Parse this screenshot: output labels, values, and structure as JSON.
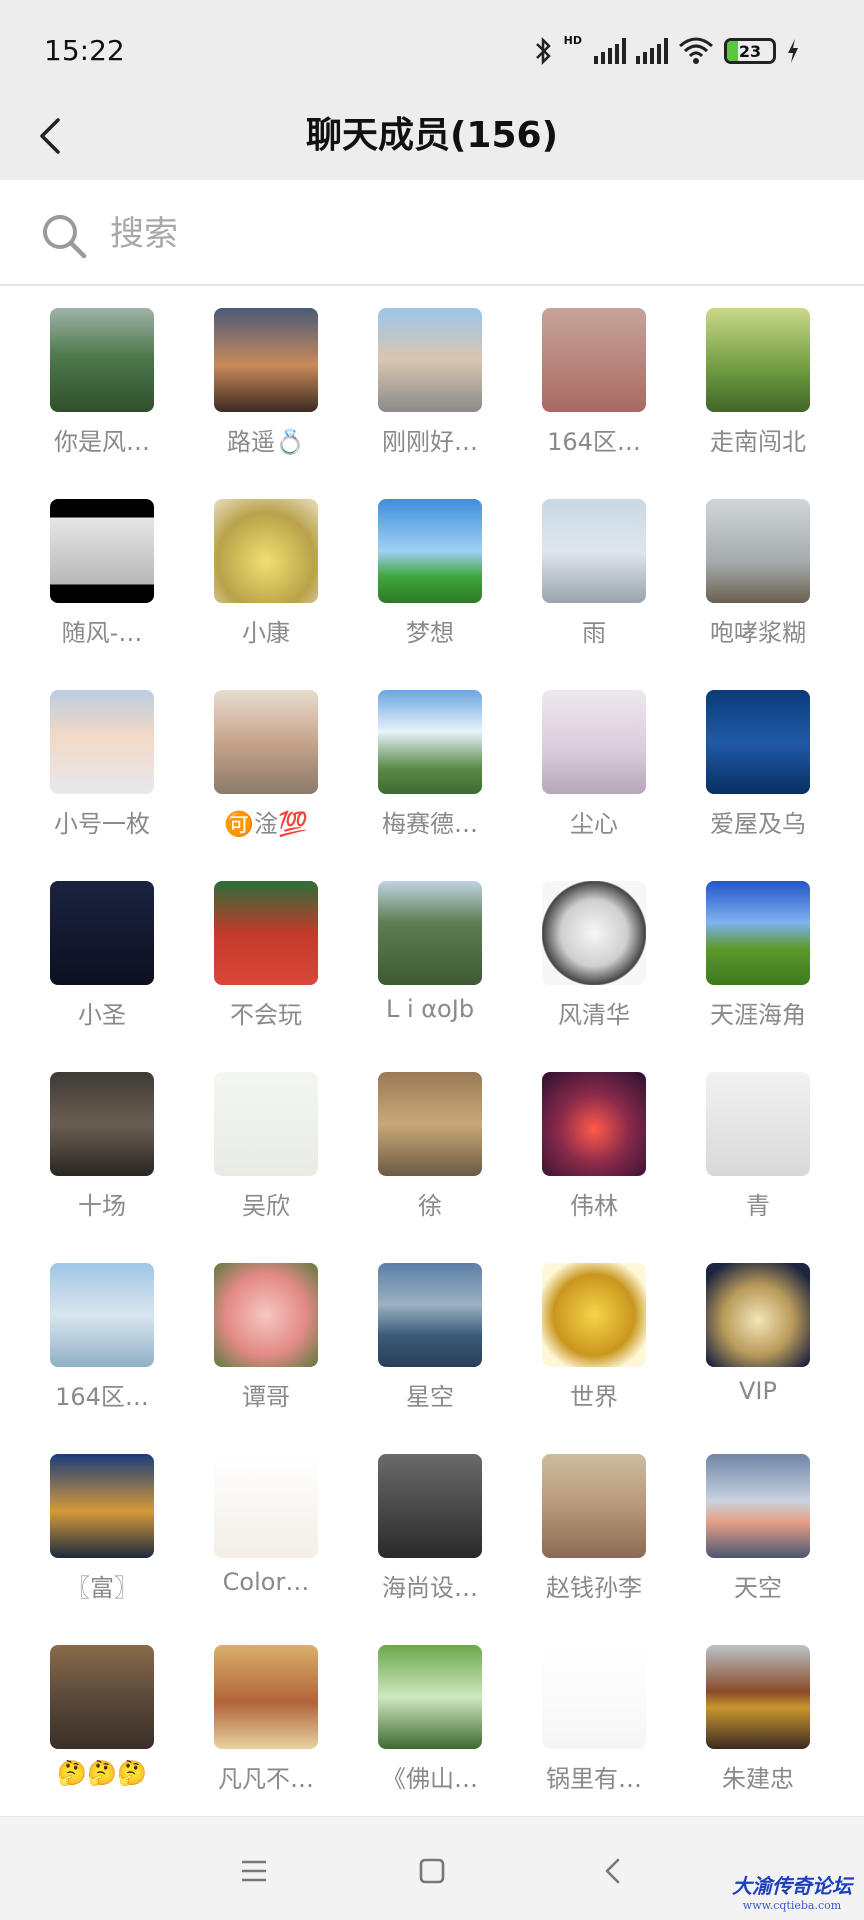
{
  "status_bar": {
    "time": "15:22",
    "network_label": "HD",
    "battery": "23",
    "battery_level": 0.23
  },
  "header": {
    "title": "聊天成员(156)"
  },
  "search": {
    "placeholder": "搜索"
  },
  "members": [
    {
      "name": "你是风…",
      "avatar": "mountain ridge"
    },
    {
      "name": "路遥💍",
      "avatar": "sunset silhouette"
    },
    {
      "name": "刚刚好…",
      "avatar": "street buildings"
    },
    {
      "name": "164区…",
      "avatar": "pink grass field"
    },
    {
      "name": "走南闯北",
      "avatar": "green valley"
    },
    {
      "name": "随风-…",
      "avatar": "flying bird"
    },
    {
      "name": "小康",
      "avatar": "yellow tulips"
    },
    {
      "name": "梦想",
      "avatar": "blue sky meadow"
    },
    {
      "name": "雨",
      "avatar": "car advertisement"
    },
    {
      "name": "咆哮浆糊",
      "avatar": "seagull on rock"
    },
    {
      "name": "小号一枚",
      "avatar": "man with glasses"
    },
    {
      "name": "🉑淦💯",
      "avatar": "people on beach"
    },
    {
      "name": "梅赛德…",
      "avatar": "landscape clouds"
    },
    {
      "name": "尘心",
      "avatar": "ink drawing woman"
    },
    {
      "name": "爱屋及乌",
      "avatar": "sea birds"
    },
    {
      "name": "小圣",
      "avatar": "man in suit dark"
    },
    {
      "name": "不会玩",
      "avatar": "child in red"
    },
    {
      "name": "L i αoJb",
      "avatar": "mountain path"
    },
    {
      "name": "风清华",
      "avatar": "ink circle logo"
    },
    {
      "name": "天涯海角",
      "avatar": "green hill sky"
    },
    {
      "name": "十场",
      "avatar": "man portrait"
    },
    {
      "name": "吴欣",
      "avatar": "sketch girl"
    },
    {
      "name": "徐",
      "avatar": "young man"
    },
    {
      "name": "伟林",
      "avatar": "red flower dark"
    },
    {
      "name": "青",
      "avatar": "signature"
    },
    {
      "name": "164区…",
      "avatar": "person arms raised"
    },
    {
      "name": "谭哥",
      "avatar": "pink peony"
    },
    {
      "name": "星空",
      "avatar": "lake town"
    },
    {
      "name": "世界",
      "avatar": "golden handshake"
    },
    {
      "name": "VIP",
      "avatar": "white cat"
    },
    {
      "name": "〖富〗",
      "avatar": "mosque night"
    },
    {
      "name": "Color…",
      "avatar": "cartoon kid"
    },
    {
      "name": "海尚设…",
      "avatar": "man bow tie"
    },
    {
      "name": "赵钱孙李",
      "avatar": "holding hands"
    },
    {
      "name": "天空",
      "avatar": "cloudy sky"
    },
    {
      "name": "🤔🤔🤔",
      "avatar": "crowd of faces"
    },
    {
      "name": "凡凡不…",
      "avatar": "vintage photo"
    },
    {
      "name": "《佛山…",
      "avatar": "man park"
    },
    {
      "name": "锅里有…",
      "avatar": "cartoon scholar"
    },
    {
      "name": "朱建忠",
      "avatar": "red pavilion"
    }
  ],
  "watermark": {
    "line1": "大渝传奇论坛",
    "line2": "www.cqtieba.com"
  }
}
